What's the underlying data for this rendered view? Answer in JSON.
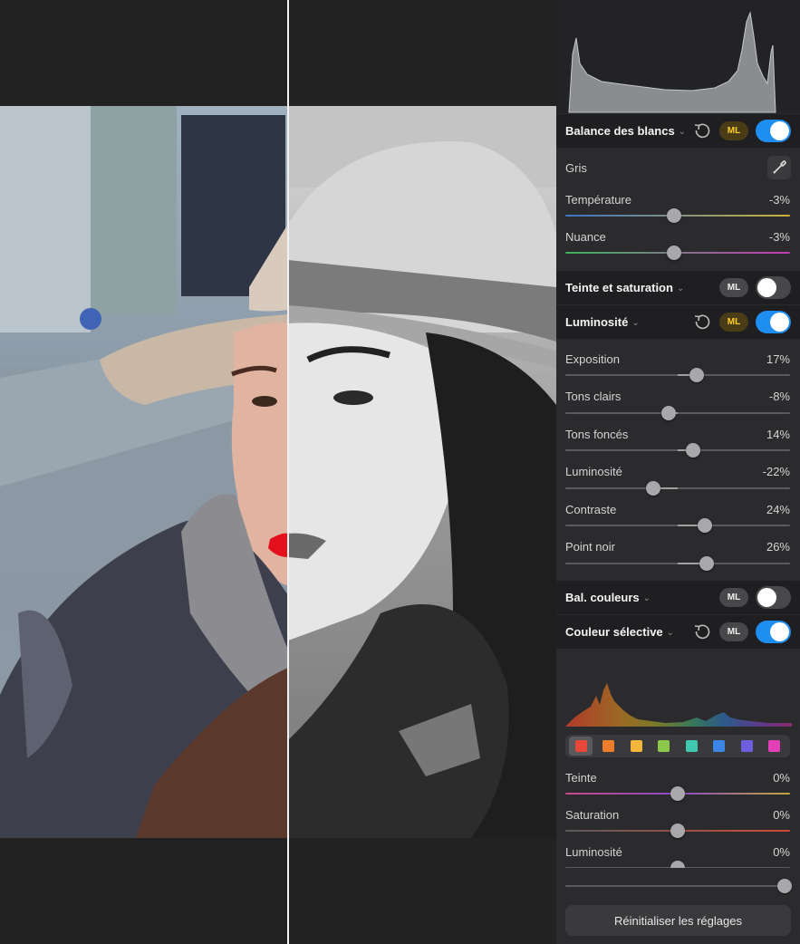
{
  "panel": {
    "white_balance": {
      "title": "Balance des blancs",
      "ml_label": "ML",
      "enabled": true,
      "gray_label": "Gris",
      "sliders": [
        {
          "label": "Température",
          "value_text": "-3%",
          "value": -3,
          "track_gradient": [
            "#3b73c5",
            "#c9b23a"
          ]
        },
        {
          "label": "Nuance",
          "value_text": "-3%",
          "value": -3,
          "track_gradient": [
            "#3bb35b",
            "#c43ab4"
          ]
        }
      ]
    },
    "hue_saturation": {
      "title": "Teinte et saturation",
      "ml_label": "ML",
      "enabled": false
    },
    "luminosity": {
      "title": "Luminosité",
      "ml_label": "ML",
      "enabled": true,
      "sliders": [
        {
          "label": "Exposition",
          "value_text": "17%",
          "value": 17
        },
        {
          "label": "Tons clairs",
          "value_text": "-8%",
          "value": -8
        },
        {
          "label": "Tons foncés",
          "value_text": "14%",
          "value": 14
        },
        {
          "label": "Luminosité",
          "value_text": "-22%",
          "value": -22
        },
        {
          "label": "Contraste",
          "value_text": "24%",
          "value": 24
        },
        {
          "label": "Point noir",
          "value_text": "26%",
          "value": 26
        }
      ]
    },
    "color_balance": {
      "title": "Bal. couleurs",
      "ml_label": "ML",
      "enabled": false
    },
    "selective_color": {
      "title": "Couleur sélective",
      "ml_label": "ML",
      "enabled": true,
      "swatches": [
        "#e8473a",
        "#ef7e2c",
        "#f2b73a",
        "#8cc84b",
        "#3fc7b0",
        "#3d86e8",
        "#6e5fe0",
        "#e23fb8"
      ],
      "selected_swatch": 0,
      "sliders": [
        {
          "label": "Teinte",
          "value_text": "0%",
          "value": 0
        },
        {
          "label": "Saturation",
          "value_text": "0%",
          "value": 0
        },
        {
          "label": "Luminosité",
          "value_text": "0%",
          "value": 0
        }
      ]
    },
    "reset_button": "Réinitialiser les réglages"
  },
  "icons": {
    "reset": "reset-icon",
    "eyedropper": "eyedropper-icon",
    "chevron": "chevron-down-icon"
  }
}
